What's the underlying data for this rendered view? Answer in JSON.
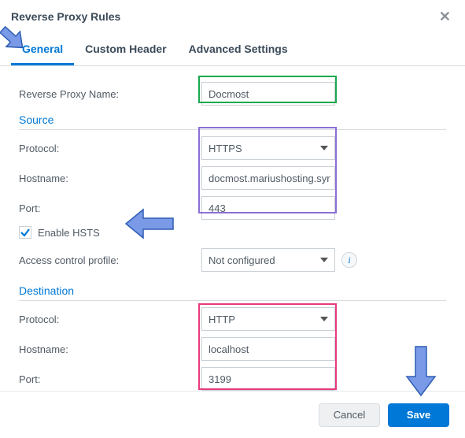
{
  "window_title": "Reverse Proxy Rules",
  "tabs": {
    "general": "General",
    "custom_header": "Custom Header",
    "advanced": "Advanced Settings"
  },
  "labels": {
    "name": "Reverse Proxy Name:",
    "protocol": "Protocol:",
    "hostname": "Hostname:",
    "port": "Port:",
    "hsts": "Enable HSTS",
    "acp": "Access control profile:"
  },
  "sections": {
    "source": "Source",
    "destination": "Destination"
  },
  "values": {
    "name": "Docmost",
    "src_protocol": "HTTPS",
    "src_hostname": "docmost.mariushosting.syr",
    "src_port": "443",
    "hsts_checked": true,
    "acp": "Not configured",
    "dst_protocol": "HTTP",
    "dst_hostname": "localhost",
    "dst_port": "3199"
  },
  "buttons": {
    "cancel": "Cancel",
    "save": "Save"
  },
  "annotation_colors": {
    "green": "#1aa84f",
    "purple": "#8b6fd6",
    "pink": "#e8397e"
  }
}
